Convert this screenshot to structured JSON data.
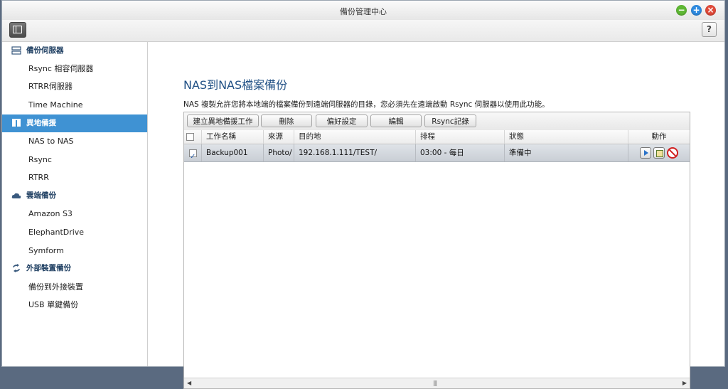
{
  "window": {
    "title": "備份管理中心"
  },
  "toolbar": {
    "help_label": "?"
  },
  "sidebar": {
    "categories": [
      {
        "label": "備份伺服器",
        "icon": "server-icon"
      },
      {
        "label": "異地備援",
        "icon": "remote-replication-icon"
      },
      {
        "label": "雲端備份",
        "icon": "cloud-icon"
      },
      {
        "label": "外部裝置備份",
        "icon": "sync-icon"
      }
    ],
    "items": [
      {
        "label": "Rsync 相容伺服器"
      },
      {
        "label": "RTRR伺服器"
      },
      {
        "label": "Time Machine"
      },
      {
        "label": "NAS to NAS"
      },
      {
        "label": "Rsync"
      },
      {
        "label": "RTRR"
      },
      {
        "label": "Amazon S3"
      },
      {
        "label": "ElephantDrive"
      },
      {
        "label": "Symform"
      },
      {
        "label": "備份到外接裝置"
      },
      {
        "label": "USB 單鍵備份"
      }
    ]
  },
  "main": {
    "heading": "NAS到NAS檔案備份",
    "description": "NAS 複製允許您將本地端的檔案備份到遠端伺服器的目錄，您必須先在遠端啟動 Rsync 伺服器以使用此功能。",
    "buttons": [
      "建立異地備援工作",
      "刪除",
      "偏好設定",
      "編輯",
      "Rsync記錄"
    ],
    "table": {
      "headers": [
        "工作名稱",
        "來源",
        "目的地",
        "排程",
        "狀態",
        "動作"
      ],
      "rows": [
        {
          "checked": true,
          "name": "Backup001",
          "source": "Photo/",
          "destination": "192.168.1.111/TEST/",
          "schedule": "03:00 - 每日",
          "status": "準備中"
        }
      ]
    }
  },
  "colors": {
    "accent": "#3f92d3",
    "heading": "#1f4f84",
    "sidebar_text": "#1f3f62"
  }
}
